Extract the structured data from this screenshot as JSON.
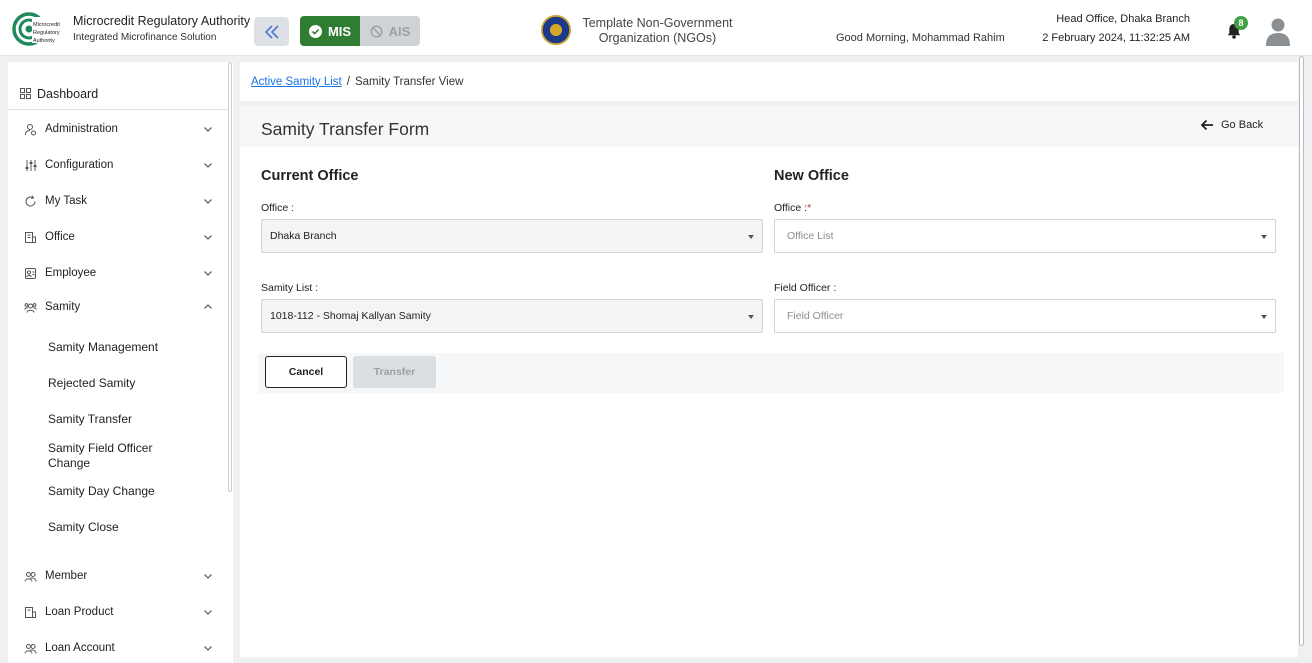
{
  "header": {
    "org_name": "Microcredit Regulatory Authority",
    "org_subtitle": "Integrated Microfinance Solution",
    "logo_text": [
      "Microcredit",
      "Regulatory",
      "Authority"
    ],
    "mode_mis": "MIS",
    "mode_ais": "AIS",
    "ngo_line1": "Template Non-Government",
    "ngo_line2": "Organization (NGOs)",
    "greeting": "Good Morning, Mohammad Rahim",
    "branch": "Head Office, Dhaka Branch",
    "datetime": "2 February 2024, 11:32:25 AM",
    "notification_count": "8",
    "accent_color": "#2e7d32"
  },
  "sidebar": {
    "dashboard": "Dashboard",
    "items": [
      {
        "label": "Administration",
        "icon": "user-cog-icon"
      },
      {
        "label": "Configuration",
        "icon": "sliders-icon"
      },
      {
        "label": "My Task",
        "icon": "task-refresh-icon"
      },
      {
        "label": "Office",
        "icon": "office-icon"
      },
      {
        "label": "Employee",
        "icon": "employee-icon"
      },
      {
        "label": "Samity",
        "icon": "group-icon",
        "expanded": true
      },
      {
        "label": "Member",
        "icon": "members-icon"
      },
      {
        "label": "Loan Product",
        "icon": "loan-product-icon"
      },
      {
        "label": "Loan Account",
        "icon": "loan-account-icon"
      }
    ],
    "samity_subitems": [
      "Samity Management",
      "Rejected Samity",
      "Samity Transfer",
      "Samity Field Officer Change",
      "Samity Day Change",
      "Samity Close"
    ]
  },
  "breadcrumb": {
    "link": "Active Samity List",
    "separator": "/",
    "current": "Samity Transfer View"
  },
  "form": {
    "title": "Samity Transfer Form",
    "go_back": "Go Back",
    "current_office": {
      "heading": "Current Office",
      "office_label": "Office :",
      "office_value": "Dhaka Branch",
      "samity_label": "Samity List :",
      "samity_value": "1018-112 - Shomaj Kallyan Samity"
    },
    "new_office": {
      "heading": "New Office",
      "office_label": "Office :",
      "office_required": "*",
      "office_placeholder": "Office List",
      "field_officer_label": "Field Officer :",
      "field_officer_placeholder": "Field Officer"
    },
    "cancel_label": "Cancel",
    "transfer_label": "Transfer"
  }
}
